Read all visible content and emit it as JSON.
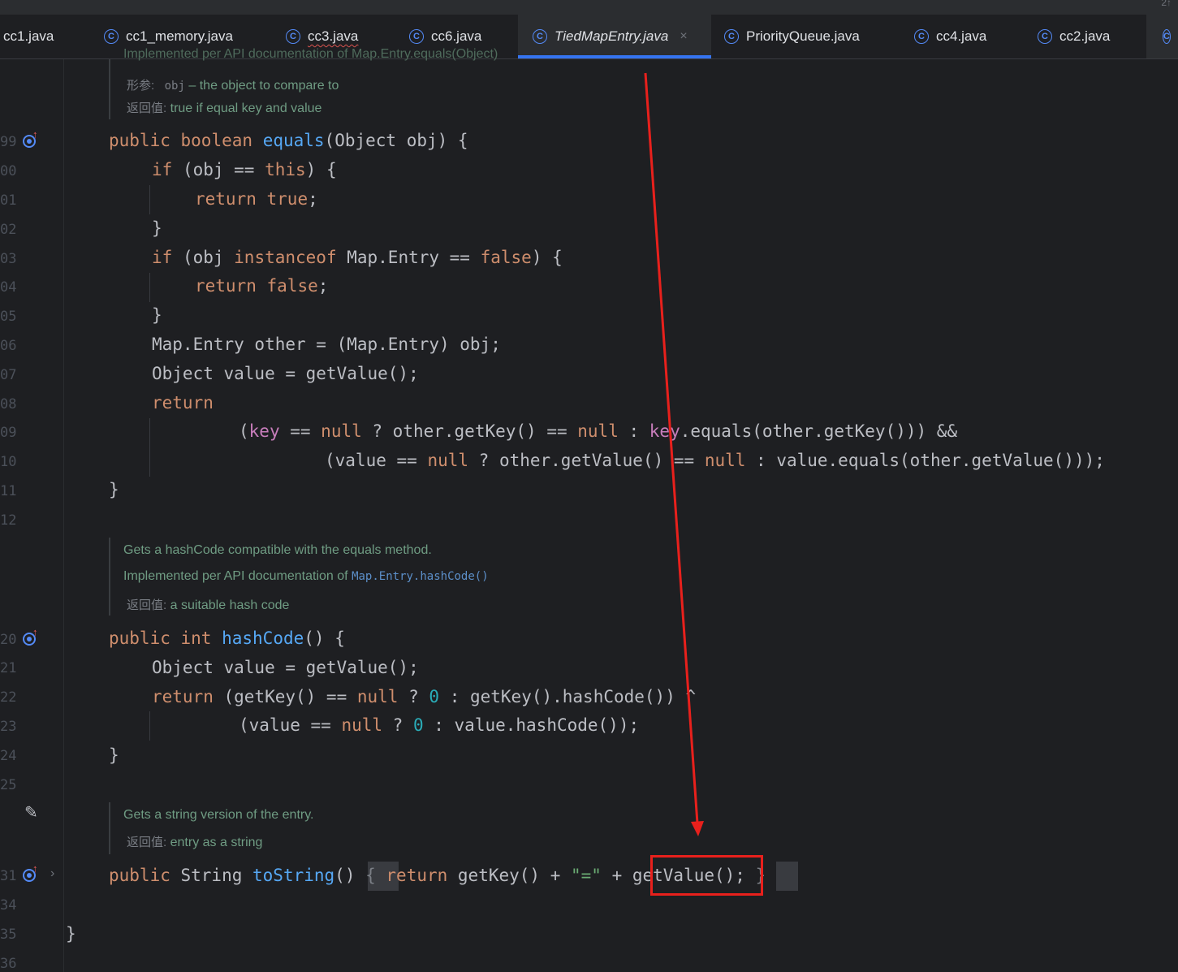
{
  "window": {
    "corner_glyph": "2↑"
  },
  "tabs": [
    {
      "label": "cc1.java",
      "icon": "class-icon"
    },
    {
      "label": "cc1_memory.java",
      "icon": "class-icon"
    },
    {
      "label": "cc3.java",
      "icon": "class-icon"
    },
    {
      "label": "cc6.java",
      "icon": "class-icon"
    },
    {
      "label": "TiedMapEntry.java",
      "icon": "class-icon",
      "active": true
    },
    {
      "label": "PriorityQueue.java",
      "icon": "class-icon"
    },
    {
      "label": "cc4.java",
      "icon": "class-icon"
    },
    {
      "label": "cc2.java",
      "icon": "class-icon"
    }
  ],
  "close_glyph": "×",
  "class_icon_glyph": "C",
  "line_numbers": [
    "99",
    "00",
    "01",
    "02",
    "03",
    "04",
    "05",
    "06",
    "07",
    "08",
    "09",
    "10",
    "11",
    "12",
    "20",
    "21",
    "22",
    "23",
    "24",
    "25",
    "31",
    "34",
    "35",
    "36"
  ],
  "docs": {
    "equals": {
      "top_line": "Implemented per API documentation of Map.Entry.equals(Object)",
      "param_tag": "形参:",
      "param_name": "obj",
      "param_text": "– the object to compare to",
      "return_tag": "返回值:",
      "return_text": "true if equal key and value"
    },
    "hashCode": {
      "line1": "Gets a hashCode compatible with the equals method.",
      "line2_text": "Implemented per API documentation of",
      "line2_link": "Map.Entry.hashCode()",
      "return_tag": "返回值:",
      "return_text": "a suitable hash code"
    },
    "toString": {
      "line1": "Gets a string version of the entry.",
      "return_tag": "返回值:",
      "return_text": "entry as a string"
    }
  },
  "code": {
    "l99": [
      "public",
      " ",
      "boolean",
      " ",
      "equals",
      "(Object obj) {"
    ],
    "l00": [
      "if",
      " (obj == ",
      "this",
      ") {"
    ],
    "l01": [
      "return",
      " ",
      "true",
      ";"
    ],
    "l02": "}",
    "l03": [
      "if",
      " (obj ",
      "instanceof",
      " Map.Entry == ",
      "false",
      ") {"
    ],
    "l04": [
      "return",
      " ",
      "false",
      ";"
    ],
    "l05": "}",
    "l06": "Map.Entry other = (Map.Entry) obj;",
    "l07": "Object value = getValue();",
    "l08": "return",
    "l09": [
      "(",
      "key",
      " == ",
      "null",
      " ? other.getKey() == ",
      "null",
      " : ",
      "key",
      ".equals(other.getKey())) &&"
    ],
    "l10": [
      "(value == ",
      "null",
      " ? other.getValue() == ",
      "null",
      " : value.equals(other.getValue()));"
    ],
    "l11": "}",
    "l20": [
      "public",
      " ",
      "int",
      " ",
      "hashCode",
      "() {"
    ],
    "l21": "Object value = getValue();",
    "l22": [
      "return",
      " (getKey() == ",
      "null",
      " ? ",
      "0",
      " : getKey().hashCode()) ^"
    ],
    "l23": [
      "(value == ",
      "null",
      " ? ",
      "0",
      " : value.hashCode());"
    ],
    "l24": "}",
    "l31": [
      "public",
      " String ",
      "toString",
      "()",
      " { ",
      "return",
      " getKey() + ",
      "\"=\"",
      " + getValue(); ",
      "}"
    ],
    "l35": "}"
  },
  "colors": {
    "keyword": "#cf8e6d",
    "function": "#56a8f5",
    "field": "#c77dbb",
    "number": "#2aacb8",
    "string": "#6aab73",
    "annotation": "#e8201c"
  },
  "annotation": {
    "highlighted_call": "getValue()"
  }
}
